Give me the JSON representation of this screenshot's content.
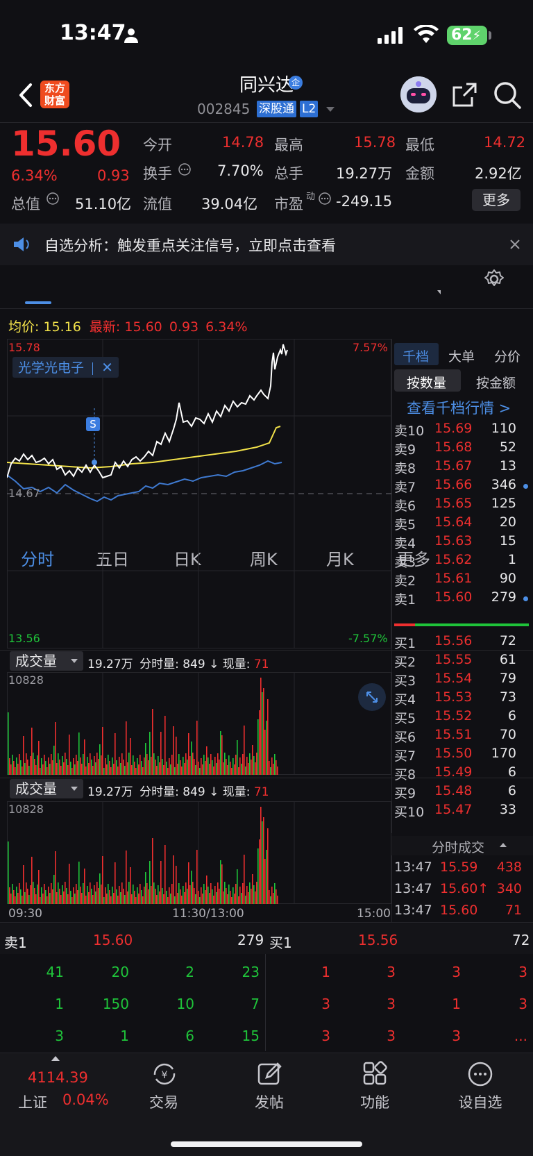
{
  "status_bar": {
    "time": "13:47",
    "battery": "62"
  },
  "header": {
    "logo": [
      "东方",
      "财富"
    ],
    "stock_name": "同兴达",
    "name_badge": "企",
    "code": "002845",
    "tag_connect": "深股通",
    "tag_level": "L2"
  },
  "quote": {
    "price": "15.60",
    "change_pct": "6.34%",
    "change": "0.93",
    "stats": [
      {
        "label": "今开",
        "value": "14.78",
        "color": "red"
      },
      {
        "label": "最高",
        "value": "15.78",
        "color": "red"
      },
      {
        "label": "最低",
        "value": "14.72",
        "color": "red"
      },
      {
        "label": "换手",
        "value": "7.70%",
        "color": "white"
      },
      {
        "label": "总手",
        "value": "19.27万",
        "color": "white"
      },
      {
        "label": "金额",
        "value": "2.92亿",
        "color": "white"
      },
      {
        "label": "总值",
        "value": "51.10亿",
        "color": "white"
      },
      {
        "label": "流值",
        "value": "39.04亿",
        "color": "white"
      },
      {
        "label": "市盈",
        "value": "-249.15",
        "color": "white"
      }
    ],
    "pe_sup": "动",
    "more_label": "更多"
  },
  "notice": {
    "text": "自选分析：触发重点关注信号，立即点击查看"
  },
  "tabs": [
    "分时",
    "五日",
    "日K",
    "周K",
    "月K",
    "更多"
  ],
  "intraday": {
    "avg_label": "均价:",
    "avg_value": "15.16",
    "latest_label": "最新:",
    "latest_value": "15.60",
    "latest_change": "0.93",
    "latest_pct": "6.34%",
    "y_high": "15.78",
    "y_low": "13.56",
    "pct_high": "7.57%",
    "pct_low": "-7.57%",
    "prev_close": "14.67",
    "indicator": "光学光电子",
    "marker": "S",
    "volume_panel": {
      "selector": "成交量",
      "total": "19.27万",
      "minute_label": "分时量:",
      "minute_value": "849",
      "now_label": "现量:",
      "now_value": "71",
      "max": "10828"
    },
    "time_start": "09:30",
    "time_mid": "11:30/13:00",
    "time_end": "15:00"
  },
  "orderbook": {
    "tabs": [
      "千档",
      "大单",
      "分价"
    ],
    "subtabs": [
      "按数量",
      "按金额"
    ],
    "view_link": "查看千档行情 >",
    "asks": [
      {
        "label": "卖10",
        "price": "15.69",
        "vol": "110"
      },
      {
        "label": "卖9",
        "price": "15.68",
        "vol": "52"
      },
      {
        "label": "卖8",
        "price": "15.67",
        "vol": "13"
      },
      {
        "label": "卖7",
        "price": "15.66",
        "vol": "346"
      },
      {
        "label": "卖6",
        "price": "15.65",
        "vol": "125"
      },
      {
        "label": "卖5",
        "price": "15.64",
        "vol": "20"
      },
      {
        "label": "卖4",
        "price": "15.63",
        "vol": "15"
      },
      {
        "label": "卖3",
        "price": "15.62",
        "vol": "1"
      },
      {
        "label": "卖2",
        "price": "15.61",
        "vol": "90"
      },
      {
        "label": "卖1",
        "price": "15.60",
        "vol": "279"
      }
    ],
    "bids": [
      {
        "label": "买1",
        "price": "15.56",
        "vol": "72"
      },
      {
        "label": "买2",
        "price": "15.55",
        "vol": "61"
      },
      {
        "label": "买3",
        "price": "15.54",
        "vol": "79"
      },
      {
        "label": "买4",
        "price": "15.53",
        "vol": "73"
      },
      {
        "label": "买5",
        "price": "15.52",
        "vol": "6"
      },
      {
        "label": "买6",
        "price": "15.51",
        "vol": "70"
      },
      {
        "label": "买7",
        "price": "15.50",
        "vol": "170"
      },
      {
        "label": "买8",
        "price": "15.49",
        "vol": "6"
      },
      {
        "label": "买9",
        "price": "15.48",
        "vol": "6"
      },
      {
        "label": "买10",
        "price": "15.47",
        "vol": "33"
      }
    ],
    "trades_title": "分时成交",
    "trades": [
      {
        "time": "13:47",
        "price": "15.59",
        "vol": "438"
      },
      {
        "time": "13:47",
        "price": "15.60↑",
        "vol": "340"
      },
      {
        "time": "13:47",
        "price": "15.60",
        "vol": "71"
      }
    ]
  },
  "queue": {
    "sell_label": "卖1",
    "sell_price": "15.60",
    "sell_total": "279",
    "buy_label": "买1",
    "buy_price": "15.56",
    "buy_total": "72",
    "sell_orders": [
      "41",
      "20",
      "2",
      "23",
      "1",
      "150",
      "10",
      "7",
      "3",
      "1",
      "6",
      "15"
    ],
    "buy_orders": [
      "1",
      "3",
      "3",
      "3",
      "3",
      "3",
      "1",
      "3",
      "3",
      "3",
      "3",
      "..."
    ]
  },
  "bottom_bar": {
    "index_value": "4114.39",
    "index_name": "上证",
    "index_pct": "0.04%",
    "items": [
      "交易",
      "发帖",
      "功能",
      "设自选"
    ]
  },
  "colors": {
    "up": "#ee2f2f",
    "down": "#1fc43a",
    "avg": "#f2e24a",
    "accent": "#4d8fe6"
  }
}
